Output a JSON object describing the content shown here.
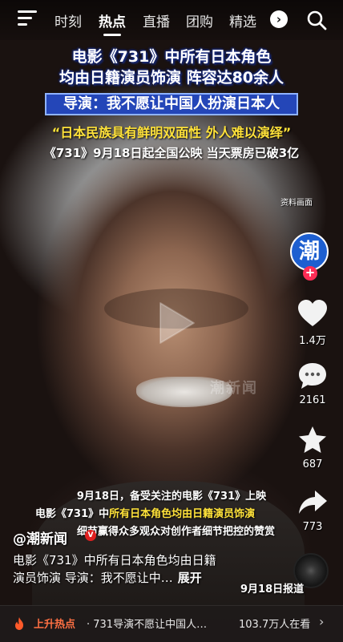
{
  "nav": {
    "tabs": [
      {
        "label": "时刻"
      },
      {
        "label": "热点"
      },
      {
        "label": "直播"
      },
      {
        "label": "团购"
      },
      {
        "label": "精选"
      }
    ],
    "more_label": "›"
  },
  "overlay": {
    "headline_line1": "电影《731》中所有日本角色",
    "headline_line2": "均由日籍演员饰演 阵容达80余人",
    "director_quote": "导演：我不愿让中国人扮演日本人",
    "yellow_quote": "“日本民族具有鲜明双面性 外人难以演绎”",
    "release_info": "《731》9月18日起全国公映 当天票房已破3亿",
    "archive_tag": "资料画面",
    "watermark": "潮新闻"
  },
  "rail": {
    "avatar_text": "潮",
    "follow_label": "+",
    "like_count": "1.4万",
    "comment_count": "2161",
    "favorite_count": "687",
    "share_count": "773"
  },
  "subtitles": {
    "line1": "9月18日，备受关注的电影《731》上映",
    "line2_prefix": "电影《731》中",
    "line2_highlight": "所有日本角色均由日籍演员饰演",
    "line3": "细节赢得众多观众对创作者细节把控的赞赏"
  },
  "post": {
    "author": "@潮新闻",
    "verified_mark": "V",
    "caption_line1": "电影《731》中所有日本角色均由日籍",
    "caption_line2": "演员饰演 导演：我不愿让中…",
    "expand_label": "展开",
    "report_tag": "9月18日报道"
  },
  "hot_bar": {
    "label": "上升热点",
    "text": "· 731导演不愿让中国人…",
    "viewers": "103.7万人在看",
    "chevron": "›"
  },
  "colors": {
    "accent_blue": "#2446b8",
    "highlight_yellow": "#ffe23a",
    "hot_orange": "#ff7043",
    "follow_red": "#fe2c55"
  }
}
